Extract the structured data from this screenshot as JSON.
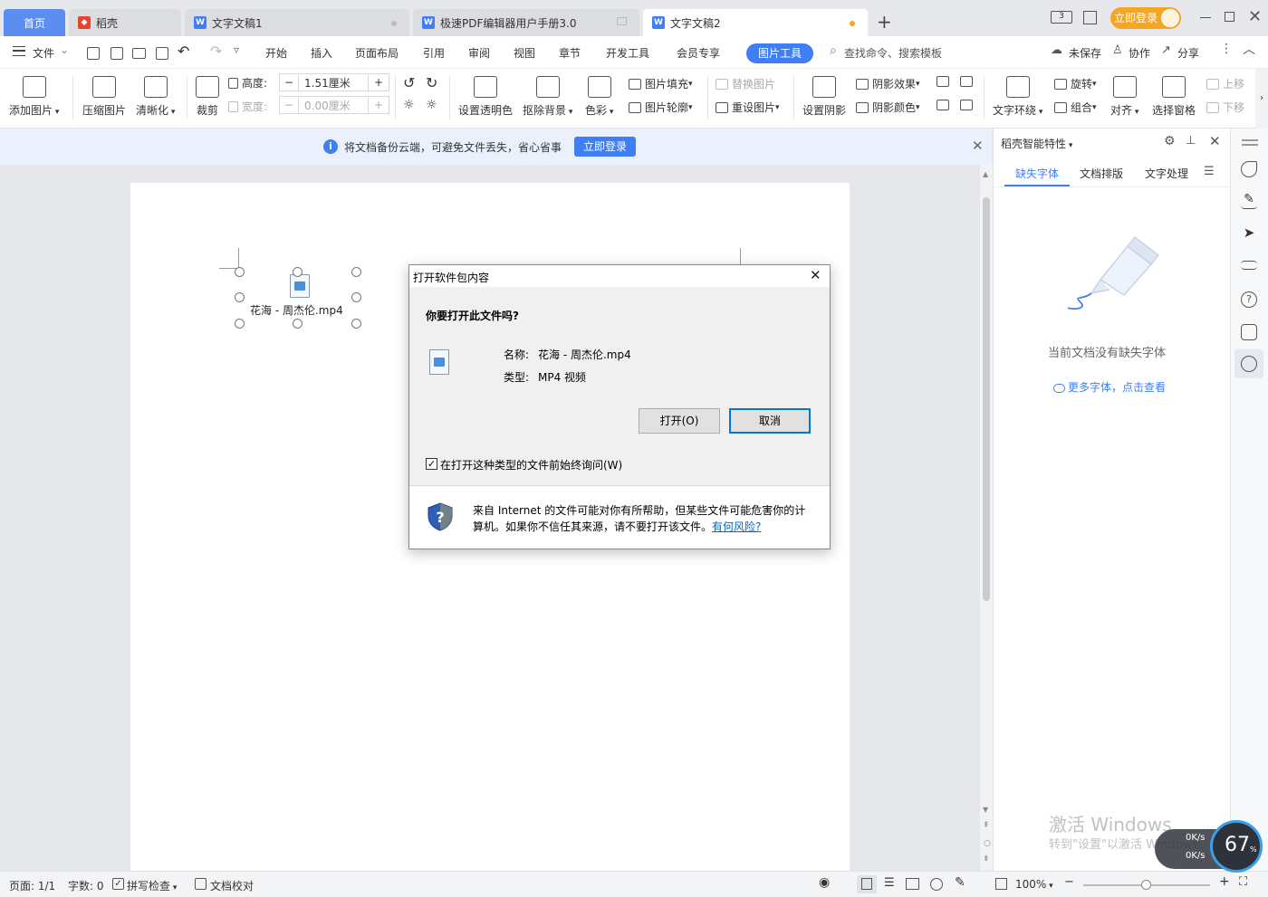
{
  "tabs": {
    "home": "首页",
    "daoke": "稻壳",
    "doc1": "文字文稿1",
    "pdf": "极速PDF编辑器用户手册3.0",
    "doc2": "文字文稿2",
    "login_btn": "立即登录"
  },
  "menu": {
    "file": "文件",
    "items": [
      "开始",
      "插入",
      "页面布局",
      "引用",
      "审阅",
      "视图",
      "章节",
      "开发工具",
      "会员专享"
    ],
    "picture_tools": "图片工具",
    "search": "查找命令、搜索模板",
    "unsaved": "未保存",
    "collab": "协作",
    "share": "分享"
  },
  "ribbon": {
    "add_picture": "添加图片",
    "compress": "压缩图片",
    "sharpen": "清晰化",
    "crop": "裁剪",
    "height_label": "高度:",
    "height_value": "1.51厘米",
    "width_label": "宽度:",
    "width_value": "0.00厘米",
    "transparent": "设置透明色",
    "remove_bg": "抠除背景",
    "color": "色彩",
    "fill": "图片填充",
    "outline": "图片轮廓",
    "replace": "替换图片",
    "reset": "重设图片",
    "shadow_set": "设置阴影",
    "shadow_effect": "阴影效果",
    "shadow_color": "阴影颜色",
    "wrap": "文字环绕",
    "rotate": "旋转",
    "group": "组合",
    "align": "对齐",
    "select_pane": "选择窗格",
    "move_up": "上移",
    "move_down": "下移"
  },
  "notice": {
    "text": "将文档备份云端，可避免文件丢失，省心省事",
    "button": "立即登录"
  },
  "document": {
    "object_label": "花海 - 周杰伦.mp4"
  },
  "dialog": {
    "title": "打开软件包内容",
    "question": "你要打开此文件吗?",
    "name_label": "名称:",
    "name_value": "花海 - 周杰伦.mp4",
    "type_label": "类型:",
    "type_value": "MP4 视频",
    "open_button": "打开(O)",
    "cancel_button": "取消",
    "checkbox_label": "在打开这种类型的文件前始终询问(W)",
    "checkbox_checked": true,
    "warning_line1": "来自 Internet 的文件可能对你有所帮助，但某些文件可能危害你的计",
    "warning_line2": "算机。如果你不信任其来源，请不要打开该文件。",
    "risk_link": "有何风险?"
  },
  "panel": {
    "title": "稻壳智能特性",
    "tabs": [
      "缺失字体",
      "文档排版",
      "文字处理"
    ],
    "empty_text": "当前文档没有缺失字体",
    "more_link": "更多字体，点击查看"
  },
  "status": {
    "page": "页面: 1/1",
    "words": "字数: 0",
    "spell": "拼写检查",
    "proof": "文档校对",
    "zoom": "100%"
  },
  "watermark": {
    "activate": "激活 Windows",
    "activate_sub": "转到\"设置\"以激活 Windows。",
    "speed_up": "0K/s",
    "speed_down": "0K/s",
    "percent": "67"
  },
  "colors": {
    "accent": "#3f7ff5",
    "home_tab": "#5b8ef0",
    "login": "#f5a623",
    "link": "#0066cc"
  }
}
